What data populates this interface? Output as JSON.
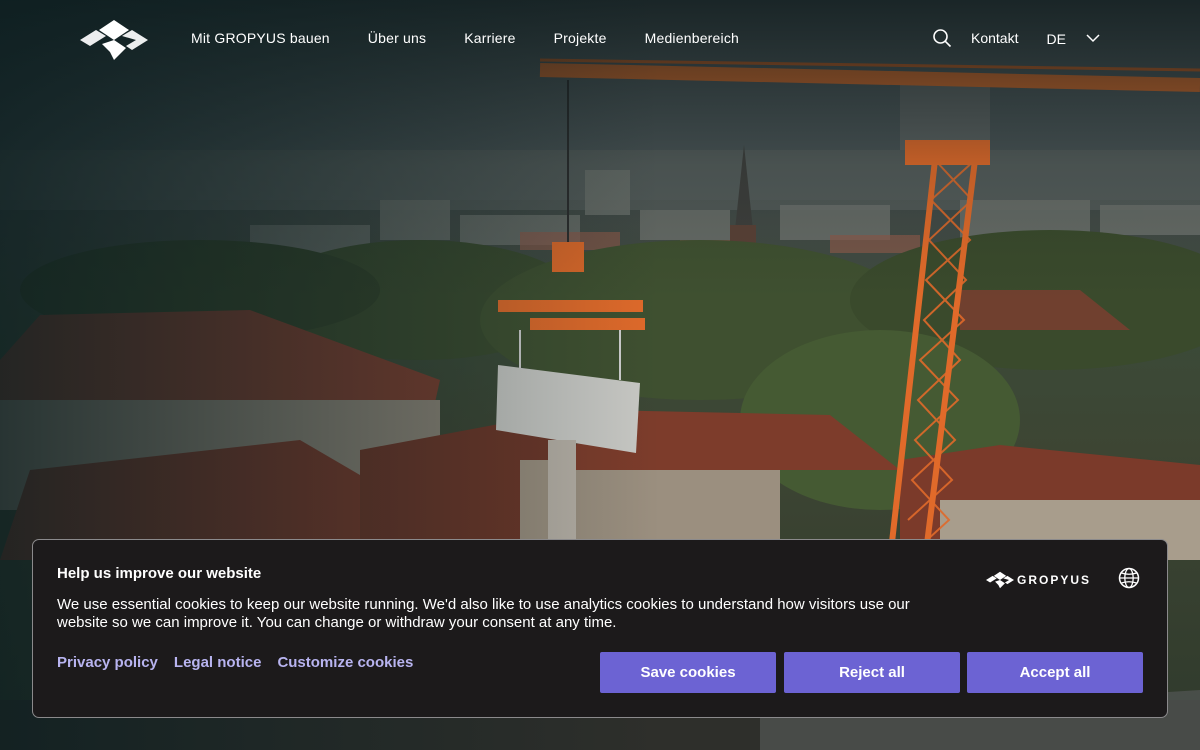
{
  "header": {
    "nav": [
      {
        "label": "Mit GROPYUS bauen"
      },
      {
        "label": "Über uns"
      },
      {
        "label": "Karriere"
      },
      {
        "label": "Projekte"
      },
      {
        "label": "Medienbereich"
      }
    ],
    "contact_label": "Kontakt",
    "language": "DE"
  },
  "cookie_banner": {
    "title": "Help us improve our website",
    "text": "We use essential cookies to keep our website running. We'd also like to use analytics cookies to understand how visitors use our website so we can improve it. You can change or withdraw your consent at any time.",
    "links": {
      "privacy": "Privacy policy",
      "legal": "Legal notice",
      "customize": "Customize cookies"
    },
    "brand": "GROPYUS",
    "buttons": {
      "save": "Save cookies",
      "reject": "Reject all",
      "accept": "Accept all"
    }
  },
  "colors": {
    "accent": "#6c63d3",
    "link": "#b8b4f0",
    "banner_bg": "#1c1a1b",
    "crane": "#e06a2a"
  }
}
